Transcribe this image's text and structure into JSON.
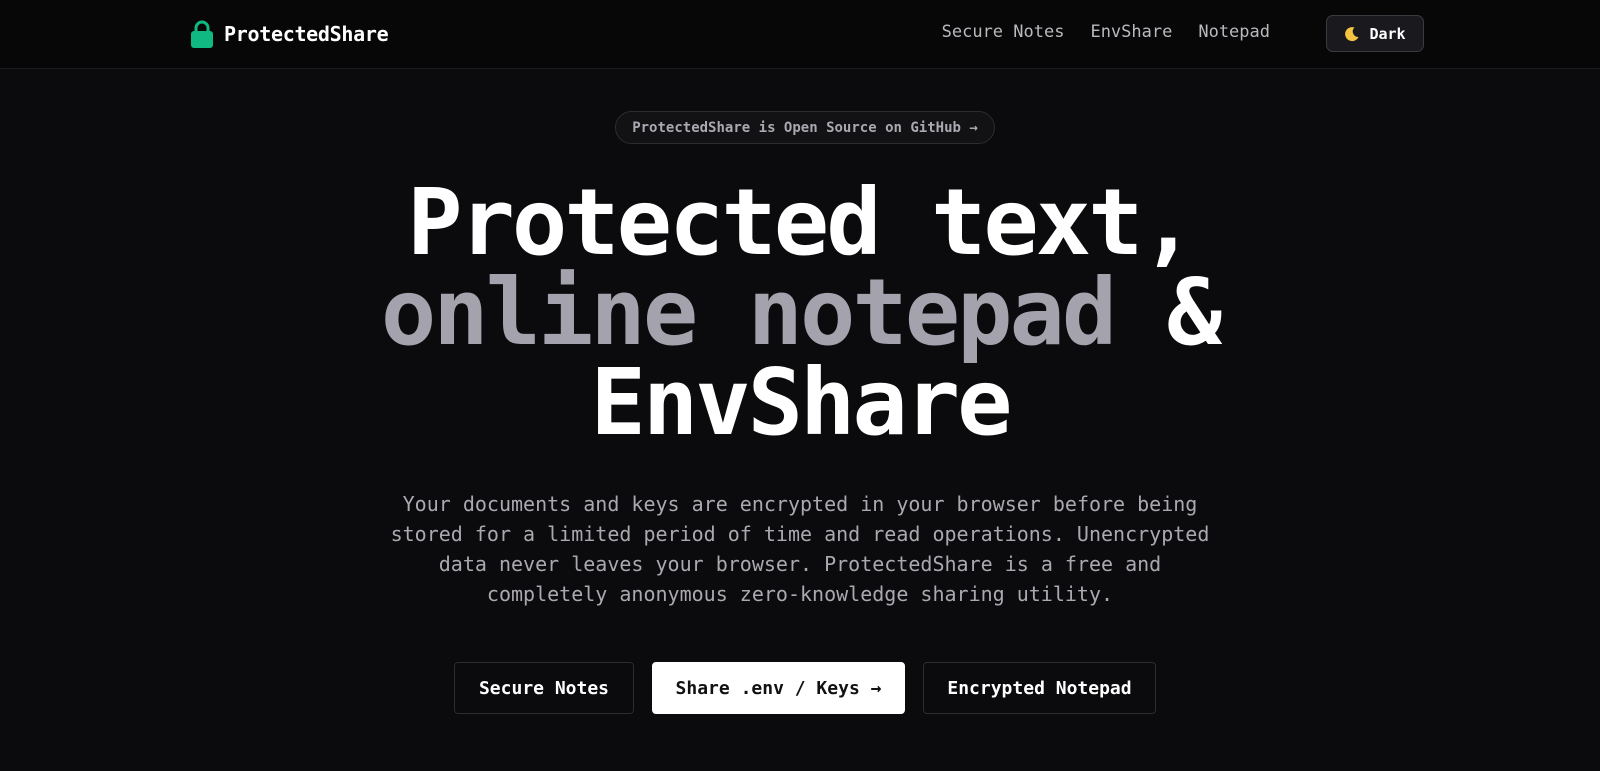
{
  "header": {
    "brand_name": "ProtectedShare",
    "brand_icon": "lock-icon",
    "brand_color": "#10b981",
    "nav": [
      "Secure Notes",
      "EnvShare",
      "Notepad"
    ],
    "theme_toggle": {
      "icon": "moon-icon",
      "label": "Dark"
    }
  },
  "hero": {
    "announcement": "ProtectedShare is Open Source on GitHub →",
    "title_line1": "Protected text,",
    "title_line2_gray": "online notepad",
    "title_line2_white": " &",
    "title_line3": "EnvShare",
    "description_lines": [
      "Your documents and keys are encrypted in your browser before being",
      "stored for a limited period of time and read operations. Unencrypted",
      "data never leaves your browser. ProtectedShare is a free and",
      "completely anonymous zero-knowledge sharing utility."
    ]
  },
  "cta": {
    "secure_notes": "Secure Notes",
    "share_env": "Share .env / Keys →",
    "encrypted_notepad": "Encrypted Notepad"
  }
}
